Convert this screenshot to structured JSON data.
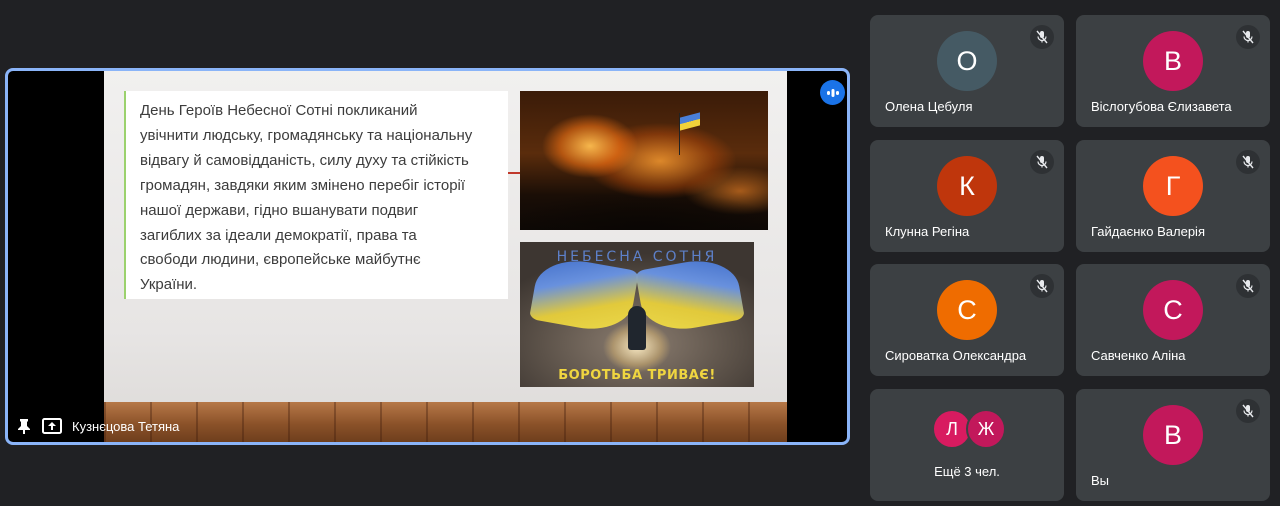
{
  "presenter": {
    "name": "Кузнєцова Тетяна",
    "icons": [
      "pin-icon",
      "present-screen-icon"
    ],
    "more_icon": "more-options-icon"
  },
  "slide": {
    "lines": [
      "День Героїв Небесної Сотні покликаний",
      "увічнити людську, громадянську та національну",
      "відвагу й самовідданість, силу духу та стійкість",
      "громадян, завдяки яким змінено перебіг історії",
      "нашої держави, гідно вшанувати подвиг",
      "загиблих за ідеали демократії, права та",
      "свободи людини, європейське майбутнє",
      "України."
    ],
    "poster_title": "НЕБЕСНА СОТНЯ",
    "poster_bottom": "БОРОТЬБА ТРИВАЄ!"
  },
  "participants": [
    {
      "initial": "О",
      "name": "Олена Цебуля",
      "color": "#455a64"
    },
    {
      "initial": "В",
      "name": "Віслогубова Єлизавета",
      "color": "#c2185b"
    },
    {
      "initial": "К",
      "name": "Клунна Регіна",
      "color": "#bf360c"
    },
    {
      "initial": "Г",
      "name": "Гайдаєнко Валерія",
      "color": "#f4511e"
    },
    {
      "initial": "С",
      "name": "Сироватка Олександра",
      "color": "#ef6c00"
    },
    {
      "initial": "С",
      "name": "Савченко Аліна",
      "color": "#c2185b"
    }
  ],
  "others": {
    "initials": [
      "Л",
      "Ж"
    ],
    "colors": [
      "#d81b60",
      "#c2185b"
    ],
    "label": "Ещё 3 чел."
  },
  "self": {
    "initial": "В",
    "name": "Вы",
    "color": "#c2185b"
  },
  "mute_icon": "mic-off-icon"
}
